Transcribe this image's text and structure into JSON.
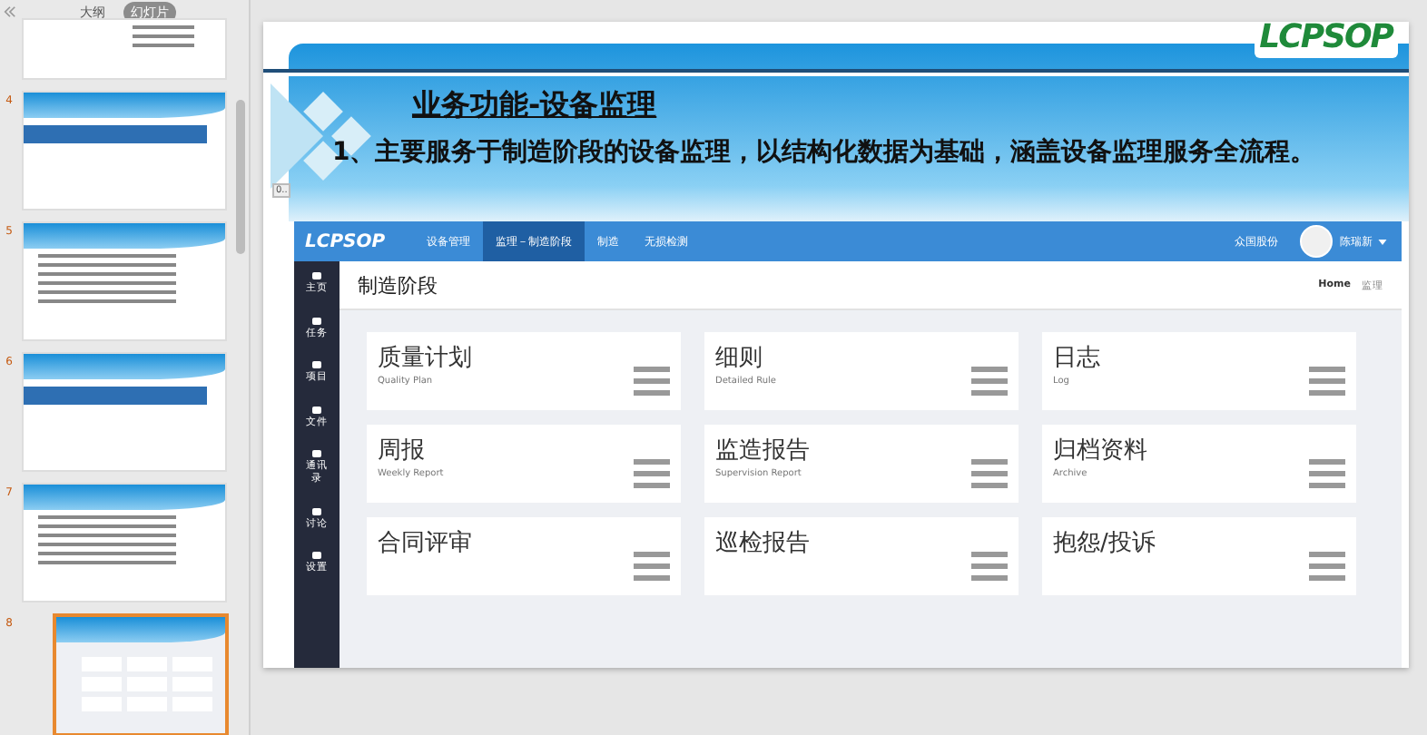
{
  "panel": {
    "tabs": [
      {
        "label": "大纲",
        "selected": false
      },
      {
        "label": "幻灯片",
        "selected": true
      }
    ],
    "slides": [
      {
        "kind": "list",
        "selected": false
      },
      {
        "number": "4",
        "kind": "section",
        "selected": false
      },
      {
        "number": "5",
        "kind": "text",
        "selected": false
      },
      {
        "number": "6",
        "kind": "section",
        "selected": false
      },
      {
        "number": "7",
        "kind": "text",
        "selected": false
      },
      {
        "number": "8",
        "kind": "app",
        "selected": true
      }
    ]
  },
  "slide": {
    "logo": "LCPSOP",
    "title": "业务功能-设备监理",
    "bullet": "1、主要服务于制造阶段的设备监理，以结构化数据为基础，涵盖设备监理服务全流程。",
    "side_tag": "0..",
    "app": {
      "logo": "LCPSOP",
      "nav": [
        {
          "label": "设备管理",
          "selected": false
        },
        {
          "label": "监理－制造阶段",
          "selected": true
        },
        {
          "label": "制造",
          "selected": false
        },
        {
          "label": "无损检测",
          "selected": false
        }
      ],
      "company": "众国股份",
      "user": "陈瑞新",
      "sidebar": [
        {
          "label": "主页"
        },
        {
          "label": "任务"
        },
        {
          "label": "项目"
        },
        {
          "label": "文件"
        },
        {
          "label": "通讯录"
        },
        {
          "label": "讨论"
        },
        {
          "label": "设置"
        }
      ],
      "page_title": "制造阶段",
      "breadcrumb": [
        "Home",
        "监理"
      ],
      "cards": [
        {
          "title": "质量计划",
          "subtitle": "Quality Plan"
        },
        {
          "title": "细则",
          "subtitle": "Detailed Rule"
        },
        {
          "title": "日志",
          "subtitle": "Log"
        },
        {
          "title": "周报",
          "subtitle": "Weekly Report"
        },
        {
          "title": "监造报告",
          "subtitle": "Supervision Report"
        },
        {
          "title": "归档资料",
          "subtitle": "Archive"
        },
        {
          "title": "合同评审"
        },
        {
          "title": "巡检报告"
        },
        {
          "title": "抱怨/投诉"
        }
      ]
    }
  }
}
